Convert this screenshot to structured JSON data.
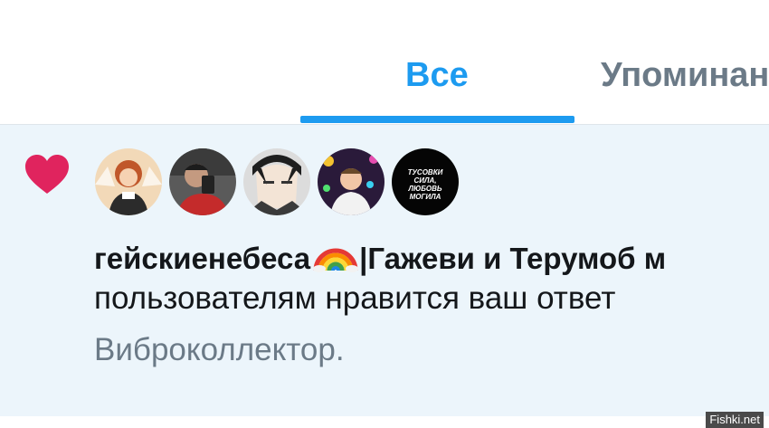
{
  "tabs": [
    {
      "label": "Все",
      "active": true
    },
    {
      "label": "Упоминан",
      "active": false
    }
  ],
  "notification": {
    "icon": "heart-icon",
    "icon_color": "#e0245e",
    "avatars": [
      "avatar-illustrated-woman",
      "avatar-selfie-man",
      "avatar-anime-character",
      "avatar-man-neon-lights",
      "avatar-text-image"
    ],
    "avatar_text_lines": [
      "ТУСОВКИ",
      "СИЛА,",
      "ЛЮБОВЬ",
      "МОГИЛА"
    ],
    "names_part1": "гейскиенебеса",
    "names_emoji": "rainbow-emoji",
    "names_part2": "|Гажеви и Терумоб м",
    "action_text": "пользователям нравится ваш ответ",
    "subject_text": "Виброколлектор."
  },
  "watermark": "Fishki.net",
  "colors": {
    "accent": "#1d9bf0",
    "background": "#ecf5fb",
    "secondary_text": "#6b7a87"
  }
}
